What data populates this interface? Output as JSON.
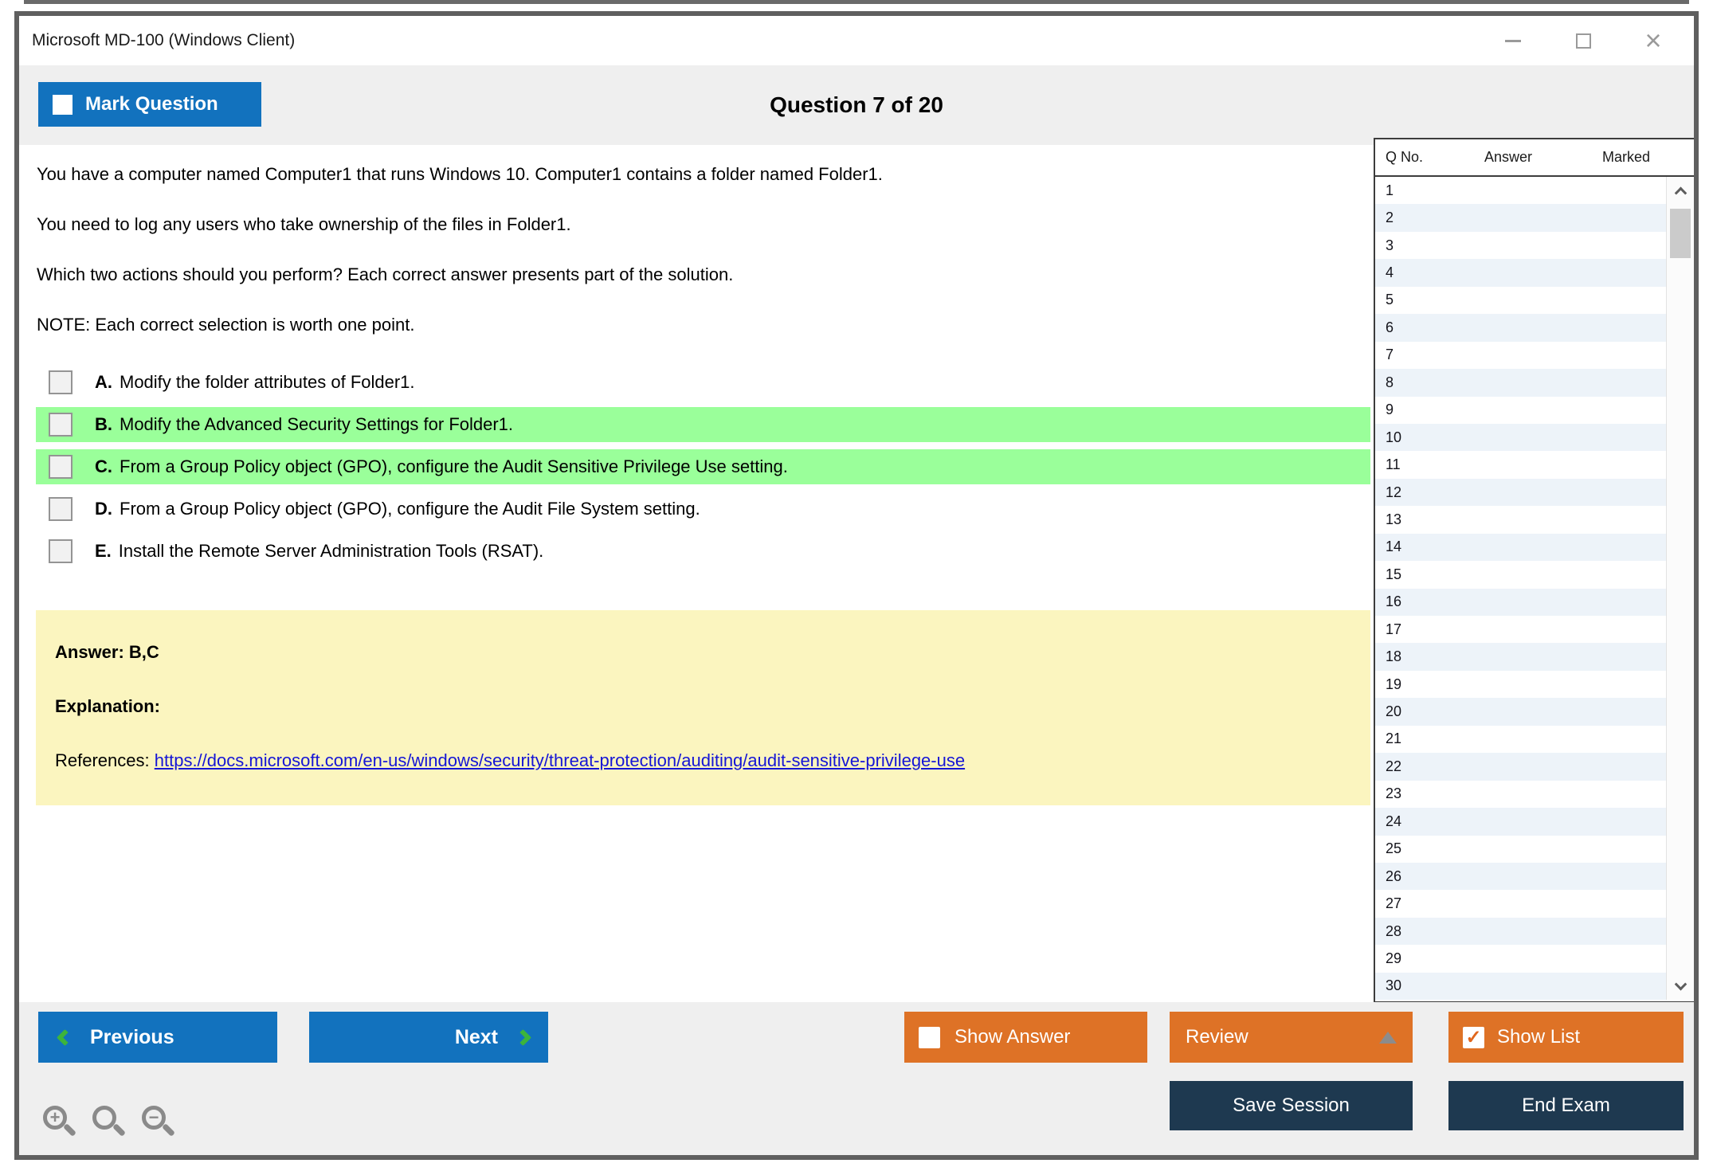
{
  "window": {
    "title": "Microsoft MD-100 (Windows Client)"
  },
  "header": {
    "mark_question_label": "Mark Question",
    "question_counter": "Question 7 of 20"
  },
  "question": {
    "paragraphs": [
      "You have a computer named Computer1 that runs Windows 10. Computer1 contains a folder named Folder1.",
      "You need to log any users who take ownership of the files in Folder1.",
      "Which two actions should you perform? Each correct answer presents part of the solution.",
      "NOTE: Each correct selection is worth one point."
    ],
    "options": [
      {
        "letter": "A.",
        "text": "Modify the folder attributes of Folder1.",
        "highlighted": false,
        "checked": false
      },
      {
        "letter": "B.",
        "text": "Modify the Advanced Security Settings for Folder1.",
        "highlighted": true,
        "checked": false
      },
      {
        "letter": "C.",
        "text": "From a Group Policy object (GPO), configure the Audit Sensitive Privilege Use setting.",
        "highlighted": true,
        "checked": false
      },
      {
        "letter": "D.",
        "text": "From a Group Policy object (GPO), configure the Audit File System setting.",
        "highlighted": false,
        "checked": false
      },
      {
        "letter": "E.",
        "text": "Install the Remote Server Administration Tools (RSAT).",
        "highlighted": false,
        "checked": false
      }
    ]
  },
  "answer_box": {
    "answer_label": "Answer: B,C",
    "explanation_label": "Explanation:",
    "references_label": "References:",
    "reference_link": "https://docs.microsoft.com/en-us/windows/security/threat-protection/auditing/audit-sensitive-privilege-use"
  },
  "question_list": {
    "columns": [
      "Q No.",
      "Answer",
      "Marked"
    ],
    "rows": [
      "1",
      "2",
      "3",
      "4",
      "5",
      "6",
      "7",
      "8",
      "9",
      "10",
      "11",
      "12",
      "13",
      "14",
      "15",
      "16",
      "17",
      "18",
      "19",
      "20",
      "21",
      "22",
      "23",
      "24",
      "25",
      "26",
      "27",
      "28",
      "29",
      "30"
    ]
  },
  "footer": {
    "previous_label": "Previous",
    "next_label": "Next",
    "show_answer_label": "Show Answer",
    "review_label": "Review",
    "show_list_label": "Show List",
    "save_session_label": "Save Session",
    "end_exam_label": "End Exam",
    "show_answer_checked": false,
    "show_list_checked": true,
    "mark_question_checked": false
  },
  "colors": {
    "accent_blue": "#1272be",
    "accent_orange": "#de7226",
    "navy": "#1e3950",
    "highlight_green": "#9aff9a",
    "arrow_green": "#3cb43c",
    "answer_box_yellow": "#fbf5bf",
    "row_stripe_blue": "#edf3f9",
    "band_gray": "#efefef",
    "window_border": "#5f5f5f"
  }
}
